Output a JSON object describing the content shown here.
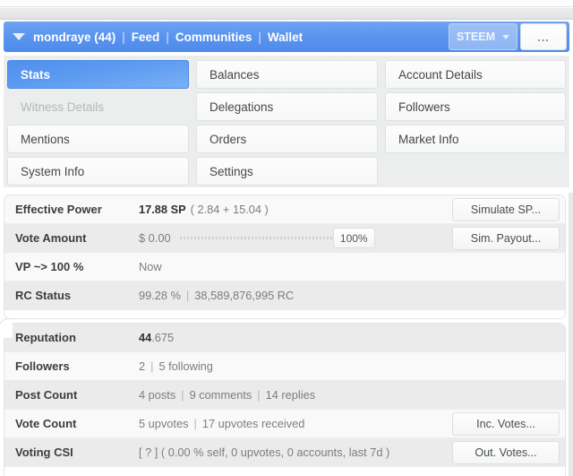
{
  "window": {
    "title_bar_present": true
  },
  "account_bar": {
    "caret_icon": "chevron-down-icon",
    "account_name": "mondraye (44)",
    "separator": "|",
    "links": [
      "Feed",
      "Communities",
      "Wallet"
    ],
    "chain_select": {
      "value": "STEEM",
      "caret_icon": "chevron-down-icon"
    },
    "more_button": "...",
    "accent_color": "#5a94ee"
  },
  "tabs": [
    {
      "label": "Stats",
      "state": "active"
    },
    {
      "label": "Balances",
      "state": "normal"
    },
    {
      "label": "Account Details",
      "state": "normal"
    },
    {
      "label": "Witness Details",
      "state": "disabled"
    },
    {
      "label": "Delegations",
      "state": "normal"
    },
    {
      "label": "Followers",
      "state": "normal"
    },
    {
      "label": "Mentions",
      "state": "normal"
    },
    {
      "label": "Orders",
      "state": "normal"
    },
    {
      "label": "Market Info",
      "state": "normal"
    },
    {
      "label": "System Info",
      "state": "normal"
    },
    {
      "label": "Settings",
      "state": "normal"
    },
    {
      "label": "",
      "state": "empty"
    }
  ],
  "stats_top": [
    {
      "label": "Effective Power",
      "value_strong": "17.88 SP",
      "value_rest": "( 2.84 + 15.04 )",
      "action": "Simulate SP..."
    },
    {
      "label": "Vote Amount",
      "value_strong": "$ 0.00",
      "slider_value": "100%",
      "action": "Sim. Payout..."
    },
    {
      "label": "VP ~> 100 %",
      "value_rest": "Now"
    },
    {
      "label": "RC Status",
      "value_rest": "99.28 %",
      "value_pipe": "|",
      "value_rest2": "38,589,876,995 RC"
    }
  ],
  "stats_bottom": [
    {
      "label": "Reputation",
      "value_strong": "44",
      "value_rest": ".675"
    },
    {
      "label": "Followers",
      "value_rest": "2",
      "value_pipe": "|",
      "value_rest2": "5 following"
    },
    {
      "label": "Post Count",
      "value_rest": "4 posts",
      "value_pipe": "|",
      "value_rest2": "9 comments",
      "value_pipe2": "|",
      "value_rest3": "14 replies"
    },
    {
      "label": "Vote Count",
      "value_rest": "5 upvotes",
      "value_pipe": "|",
      "value_rest2": "17 upvotes received",
      "action": "Inc. Votes..."
    },
    {
      "label": "Voting CSI",
      "value_rest": "[ ? ] ( 0.00 % self, 0 upvotes, 0 accounts, last 7d )",
      "action": "Out. Votes..."
    }
  ]
}
